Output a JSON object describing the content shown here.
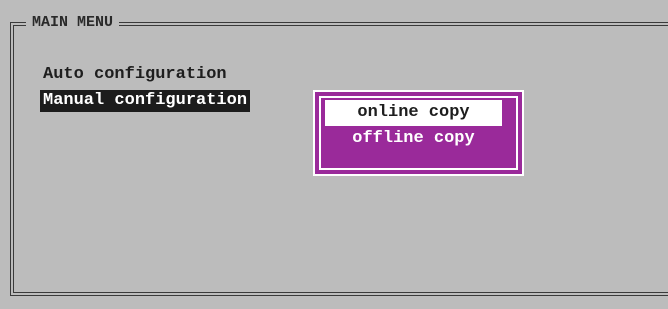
{
  "main_menu": {
    "title": "MAIN MENU",
    "items": [
      {
        "label": "Auto configuration",
        "selected": false
      },
      {
        "label": "Manual configuration",
        "selected": true
      }
    ]
  },
  "submenu": {
    "options": [
      {
        "label": "online copy",
        "selected": true
      },
      {
        "label": "offline copy",
        "selected": false
      }
    ]
  },
  "colors": {
    "background": "#bcbcbc",
    "selection_dark": "#1c1c1c",
    "popup_purple": "#9a2a9a",
    "popup_highlight": "#ffffff"
  }
}
